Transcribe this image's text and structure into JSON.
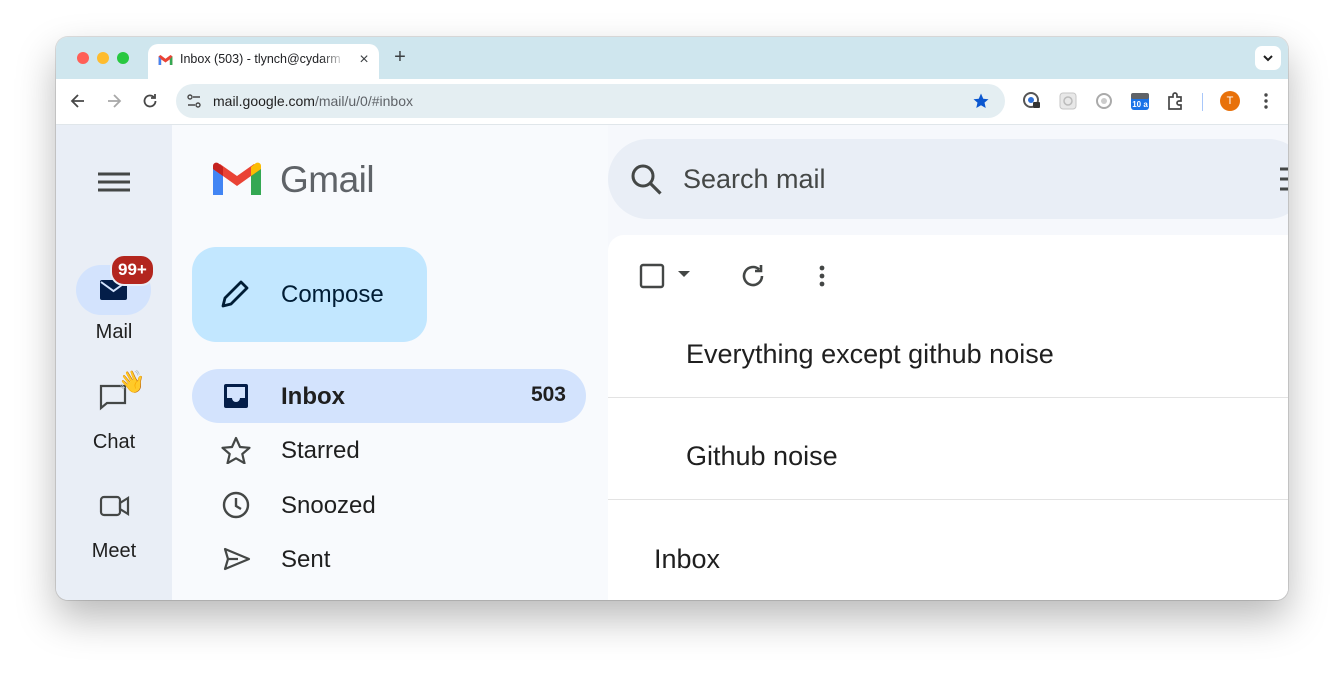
{
  "browser": {
    "tab_title": "Inbox (503) - tlynch@cydarm",
    "new_tab": "+",
    "close_tab": "×",
    "url_host": "mail.google.com",
    "url_path": "/mail/u/0/#inbox",
    "extension_badge": "10 a",
    "profile_initial": "T"
  },
  "rail": {
    "mail_label": "Mail",
    "mail_badge": "99+",
    "chat_label": "Chat",
    "chat_emoji": "👋",
    "meet_label": "Meet"
  },
  "gmail": {
    "logo_text": "Gmail",
    "compose_label": "Compose",
    "nav": [
      {
        "label": "Inbox",
        "count": "503",
        "icon": "inbox-icon"
      },
      {
        "label": "Starred",
        "icon": "star-icon"
      },
      {
        "label": "Snoozed",
        "icon": "clock-icon"
      },
      {
        "label": "Sent",
        "icon": "send-icon"
      }
    ],
    "search_placeholder": "Search mail",
    "sections": [
      "Everything except github noise",
      "Github noise",
      "Inbox"
    ]
  },
  "colors": {
    "accent": "#0b57d0",
    "compose_bg": "#c2e7ff",
    "active_nav": "#d3e3fd",
    "badge": "#b3261e"
  }
}
